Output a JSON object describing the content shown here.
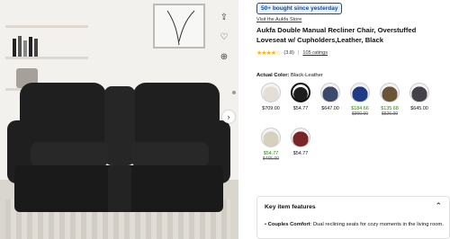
{
  "product": {
    "badge": "50+ bought since yesterday",
    "store_link": "Visit the Aukfa Store",
    "title": "Aukfa Double Manual Recliner Chair, Overstuffed Loveseat w/ Cupholders,Leather, Black",
    "rating_count": "(3.8)",
    "ratings_link": "105 ratings",
    "stars": "★★★★☆"
  },
  "actual_color": {
    "label": "Actual Color:",
    "value": "Black-Leather"
  },
  "variants": [
    {
      "price": "$709.00",
      "old": "",
      "green": false,
      "selected": false,
      "swatch": "#e3dfd7"
    },
    {
      "price": "$54.77",
      "old": "",
      "green": false,
      "selected": true,
      "swatch": "#1e1e1e"
    },
    {
      "price": "$647.00",
      "old": "",
      "green": false,
      "selected": false,
      "swatch": "#3a4a6b"
    },
    {
      "price": "$184.66",
      "old": "$900.00",
      "green": true,
      "selected": false,
      "swatch": "#1f3a86"
    },
    {
      "price": "$135.68",
      "old": "$526.00",
      "green": true,
      "selected": false,
      "swatch": "#6b5537"
    },
    {
      "price": "$645.00",
      "old": "",
      "green": false,
      "selected": false,
      "swatch": "#45414a"
    },
    {
      "price": "$54.77",
      "old": "$465.00",
      "green": true,
      "selected": false,
      "swatch": "#d8d0be"
    },
    {
      "price": "$54.77",
      "old": "",
      "green": false,
      "selected": false,
      "swatch": "#7b2626"
    }
  ],
  "key_features": {
    "title": "Key item features",
    "item_bold": "Couples Comfort",
    "item_text": ": Dual reclining seats for cozy moments in the living room."
  },
  "icons": {
    "share": "share-icon",
    "favorite": "heart-icon",
    "zoom": "zoom-in-icon",
    "next": "chevron-right-icon",
    "collapse": "chevron-up-icon"
  },
  "colors": {
    "accent_blue": "#0a4da2",
    "sale_green": "#2a8703",
    "star_yellow": "#ffb400"
  }
}
